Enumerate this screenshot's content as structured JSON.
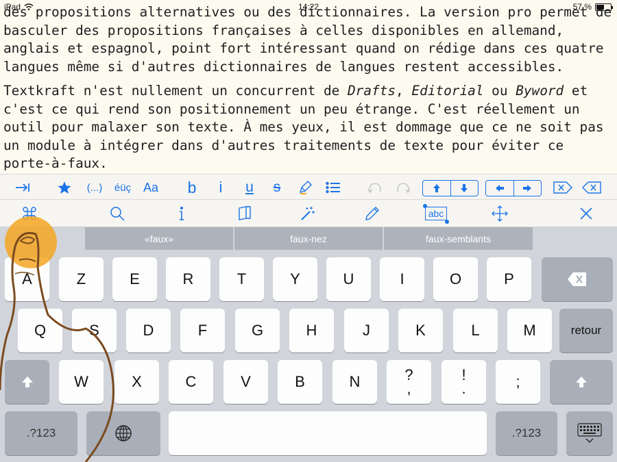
{
  "status": {
    "device": "iPad",
    "time": "14:22",
    "battery": "57 %",
    "battery_level": 0.57
  },
  "editor": {
    "paragraphs": [
      {
        "lines": [
          "des propositions alternatives ou des dictionnaires. La version pro permet de",
          "basculer des propositions françaises à celles disponibles en allemand,",
          "anglais et espagnol, point fort intéressant quand on rédige dans ces quatre",
          "langues même si d'autres dictionnaires de langues restent accessibles."
        ]
      },
      {
        "segments": [
          "Textkraft n'est nullement un concurrent de ",
          "Drafts",
          ", ",
          "Editorial",
          " ou ",
          "Byword",
          " et"
        ],
        "lines": [
          "c'est ce qui rend son positionnement un peu étrange. C'est réellement un",
          "outil pour malaxer son texte. À mes yeux, il est dommage que ce ne soit pas",
          "un module à intégrer dans d'autres traitements de texte pour éviter ce",
          "porte-à-faux."
        ]
      }
    ]
  },
  "toolbar": {
    "ellipsis": "(...)",
    "accents": "éüç",
    "case": "Aa",
    "bold": "b",
    "italic": "i",
    "underline": "u",
    "strike": "s",
    "icons": [
      "tab-icon",
      "star-icon",
      "highlighter-icon",
      "list-icon",
      "undo-icon",
      "redo-icon",
      "arrow-up-icon",
      "arrow-down-icon",
      "arrow-left-icon",
      "arrow-right-icon",
      "delete-word-forward-icon",
      "delete-word-backward-icon"
    ]
  },
  "toolbar2": {
    "select_label": "abc",
    "icons": [
      "command-icon",
      "search-icon",
      "info-icon",
      "book-icon",
      "magic-wand-icon",
      "pencil-icon",
      "select-text-icon",
      "move-icon",
      "close-icon"
    ]
  },
  "suggestions": [
    "«faux»",
    "faux-nez",
    "faux-semblants"
  ],
  "keyboard": {
    "row1": [
      "A",
      "Z",
      "E",
      "R",
      "T",
      "Y",
      "U",
      "I",
      "O",
      "P"
    ],
    "row2": [
      "Q",
      "S",
      "D",
      "F",
      "G",
      "H",
      "J",
      "K",
      "L",
      "M"
    ],
    "return_label": "retour",
    "row3": [
      "W",
      "X",
      "C",
      "V",
      "B",
      "N"
    ],
    "punct": [
      [
        "?",
        ","
      ],
      [
        "!",
        "."
      ],
      [
        ";",
        ""
      ]
    ],
    "numbers_label": ".?123",
    "colors": {
      "accent": "#1a73e8",
      "keyboard_bg": "#d1d5db",
      "suggestion_bar": "#aeb3bb",
      "finger_highlight": "#f5a623"
    }
  }
}
